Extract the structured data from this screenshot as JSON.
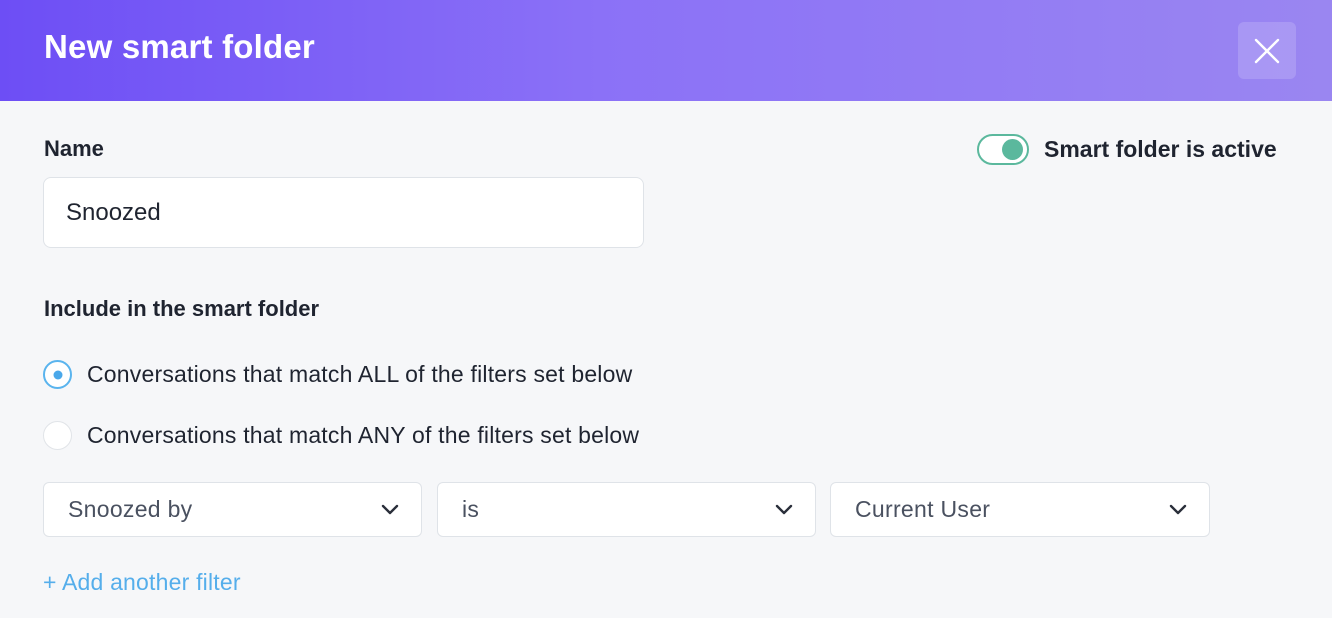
{
  "header": {
    "title": "New smart folder",
    "close_icon": "close-icon"
  },
  "name": {
    "label": "Name",
    "value": "Snoozed",
    "placeholder": ""
  },
  "active_toggle": {
    "label": "Smart folder is active",
    "on": true,
    "color": "#5bb89d"
  },
  "include": {
    "label": "Include in the smart folder",
    "options": [
      {
        "label": "Conversations that match ALL of the filters set below",
        "selected": true
      },
      {
        "label": "Conversations that match ANY of the filters set below",
        "selected": false
      }
    ]
  },
  "filter": {
    "field": "Snoozed by",
    "operator": "is",
    "value": "Current User",
    "chevron_icon": "chevron-down-icon"
  },
  "add_filter_label": "+ Add another filter",
  "colors": {
    "header_start": "#6d4ef5",
    "header_end": "#9a86f1",
    "link": "#55aeeb",
    "radio_selected": "#4aa8ea"
  }
}
